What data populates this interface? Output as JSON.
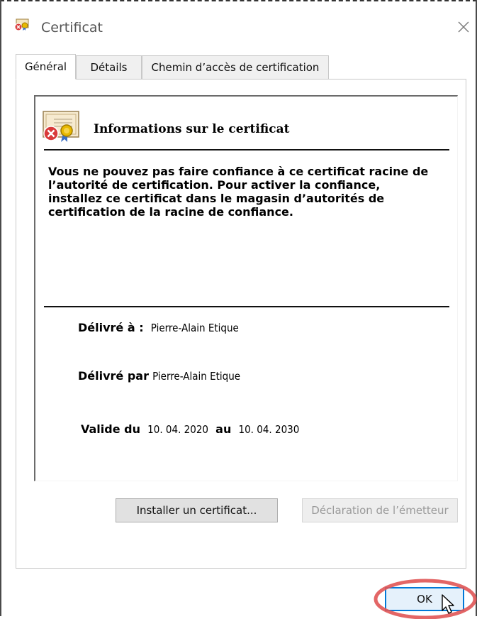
{
  "window": {
    "title": "Certificat",
    "close_icon": "close-icon"
  },
  "tabs": [
    {
      "label": "Général",
      "active": true
    },
    {
      "label": "Détails",
      "active": false
    },
    {
      "label": "Chemin d’accès de certification",
      "active": false
    }
  ],
  "info": {
    "heading": "Informations sur le certificat",
    "warning": "Vous ne pouvez pas faire confiance à ce certificat racine de l’autorité de certification. Pour activer la confiance, installez ce certificat dans le magasin d’autorités de certification de la racine de confiance.",
    "issued_to_label": "Délivré à :",
    "issued_to_value": "Pierre-Alain Etique",
    "issued_by_label": "Délivré par",
    "issued_by_value": "Pierre-Alain Etique",
    "valid_from_label": "Valide du",
    "valid_from_value": "10. 04. 2020",
    "valid_to_label": "au",
    "valid_to_value": "10. 04. 2030"
  },
  "buttons": {
    "install": "Installer un certificat...",
    "issuer_statement": "Déclaration de l’émetteur",
    "ok": "OK"
  },
  "colors": {
    "accent": "#0078d7",
    "highlight_ring": "#e05555",
    "error_red": "#d93a3a"
  }
}
